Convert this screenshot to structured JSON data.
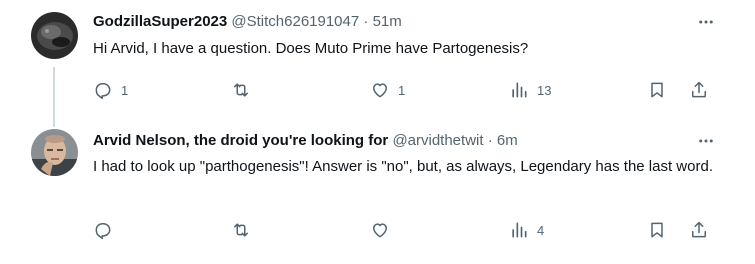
{
  "tweets": [
    {
      "display_name": "GodzillaSuper2023",
      "handle": "@Stitch626191047",
      "separator": "·",
      "time": "51m",
      "text": "Hi Arvid, I have a question. Does Muto Prime have Partogenesis?",
      "replies": "1",
      "retweets": "",
      "likes": "1",
      "views": "13"
    },
    {
      "display_name": "Arvid Nelson, the droid you're looking for",
      "handle": "@arvidthetwit",
      "separator": "·",
      "time": "6m",
      "text": "I had to look up \"parthogenesis\"! Answer is \"no\", but, as always, Legendary has the last word.",
      "replies": "",
      "retweets": "",
      "likes": "",
      "views": "4"
    }
  ],
  "colors": {
    "text": "#0f1419",
    "secondary": "#536471",
    "thread_line": "#cfd9de"
  }
}
